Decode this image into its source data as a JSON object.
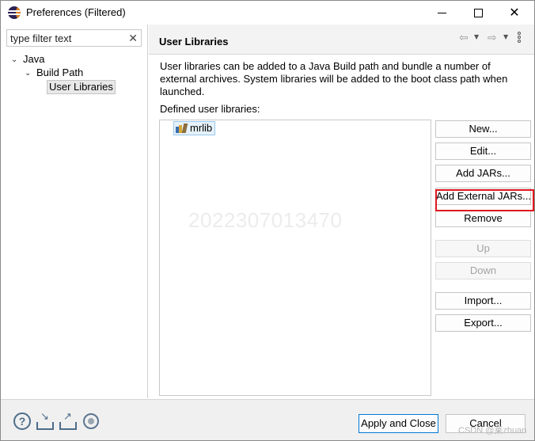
{
  "window": {
    "title": "Preferences (Filtered)"
  },
  "filter": {
    "value": "type filter text"
  },
  "tree": {
    "items": [
      {
        "label": "Java",
        "expanded": true
      },
      {
        "label": "Build Path",
        "expanded": true
      },
      {
        "label": "User Libraries",
        "selected": true
      }
    ]
  },
  "page": {
    "title": "User Libraries",
    "description": "User libraries can be added to a Java Build path and bundle a number of external archives. System libraries will be added to the boot class path when launched.",
    "defined_label": "Defined user libraries:",
    "libraries": [
      "mrlib"
    ],
    "watermark": "2022307013470"
  },
  "buttons": {
    "new": "New...",
    "edit": "Edit...",
    "add_jars": "Add JARs...",
    "add_external_jars": "Add External JARs...",
    "remove": "Remove",
    "up": "Up",
    "down": "Down",
    "import": "Import...",
    "export": "Export..."
  },
  "footer": {
    "apply_close": "Apply and Close",
    "cancel": "Cancel",
    "credit": "CSDN @莱zhuan"
  },
  "colors": {
    "highlight": "#e0161f",
    "default_button_border": "#0078d4",
    "selection_bg": "#e5f1fb"
  }
}
